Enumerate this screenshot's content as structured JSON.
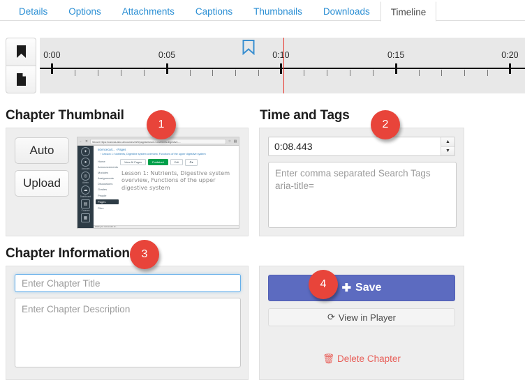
{
  "tabs": [
    {
      "label": "Details",
      "active": false
    },
    {
      "label": "Options",
      "active": false
    },
    {
      "label": "Attachments",
      "active": false
    },
    {
      "label": "Captions",
      "active": false
    },
    {
      "label": "Thumbnails",
      "active": false
    },
    {
      "label": "Downloads",
      "active": false
    },
    {
      "label": "Timeline",
      "active": true
    }
  ],
  "timeline": {
    "bookmark_button_icon": "bookmark-icon",
    "page_button_icon": "page-icon",
    "labels": [
      "0:00",
      "0:05",
      "0:10",
      "0:15",
      "0:20"
    ],
    "label_positions_pct": [
      2.5,
      26.2,
      49.7,
      73.4,
      96.9
    ],
    "minor_ticks_per_interval": 4,
    "playhead_pct": 50.2,
    "playhead_color": "#e8342a",
    "bookmark_marker_pct": 43.0,
    "bookmark_marker_color": "#3a8fd0",
    "ruler_background": "#e8e8e8"
  },
  "thumbnail_section": {
    "heading": "Chapter Thumbnail",
    "badge": "1",
    "auto_label": "Auto",
    "upload_label": "Upload",
    "preview": {
      "omnibox_secure": "Secure",
      "omnibox_url": "https://canvas.abc.uk/courses/229/pages/lesson-1-nutrients-digestive-...",
      "breadcrumb_course": "sciencecart...",
      "breadcrumb_sep": "›",
      "breadcrumb_pages": "Pages",
      "breadcrumb_sub": "› Lesson 1: Nutrients, Digestive system overview, Functions of the upper digestive system",
      "nav_items": [
        "Home",
        "Announcements",
        "Modules",
        "Assignments",
        "Discussions",
        "Grades",
        "People",
        "Pages",
        "Files"
      ],
      "nav_selected": "Pages",
      "action_view_all": "View All Pages",
      "action_published": "Published",
      "action_edit": "Edit",
      "action_gear": "⚙▾",
      "page_title": "Lesson 1: Nutrients, Digestive system overview, Functions of the upper digestive system",
      "statusbar": "Waiting for canvas.abc.uk...",
      "sidebar_items": [
        "Account",
        "Admin",
        "Dashboard",
        "Courses",
        "Calendar"
      ]
    }
  },
  "time_and_tags": {
    "heading": "Time and Tags",
    "badge": "2",
    "time_value": "0:08.443",
    "tags_placeholder": "Enter comma separated Search Tags\naria-title=",
    "spinner_up_icon": "caret-up-icon",
    "spinner_down_icon": "caret-down-icon"
  },
  "chapter_information": {
    "heading": "Chapter Information",
    "badge": "3",
    "title_placeholder": "Enter Chapter Title",
    "title_value": "",
    "description_placeholder": "Enter Chapter Description",
    "description_value": ""
  },
  "actions": {
    "badge": "4",
    "save_label": "Save",
    "save_icon": "plus-icon",
    "save_color": "#5c6bc0",
    "view_label": "View in Player",
    "view_icon": "refresh-icon",
    "delete_label": "Delete Chapter",
    "delete_icon": "trash-icon",
    "delete_color": "#e8605a"
  }
}
